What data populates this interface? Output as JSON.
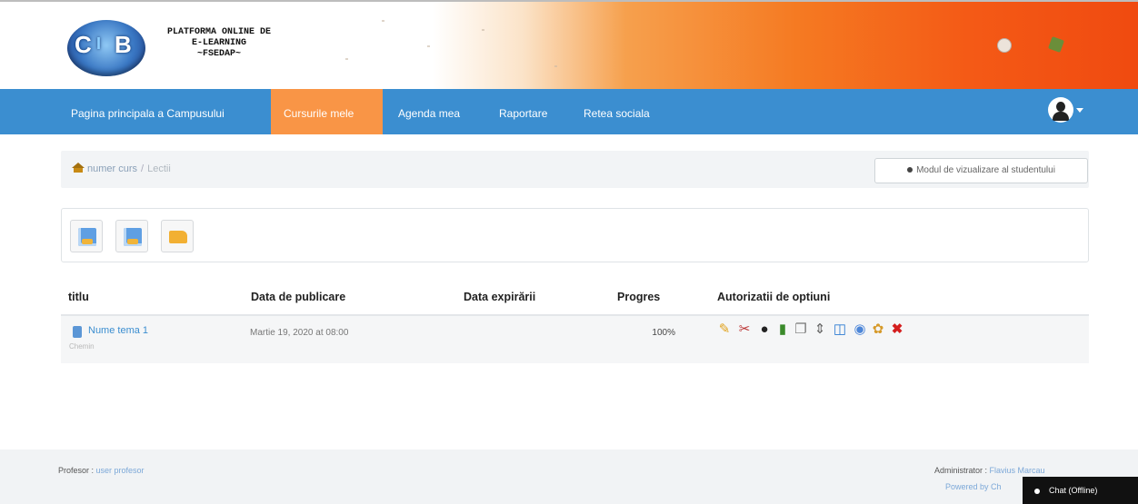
{
  "header": {
    "logo_letters": [
      "C",
      "I",
      "B"
    ],
    "site_title_lines": [
      "PLATFORMA ONLINE DE",
      "E-LEARNING",
      "~FSEDAP~"
    ]
  },
  "nav": {
    "items": [
      {
        "label": "Pagina principala a Campusului",
        "active": false
      },
      {
        "label": "Cursurile mele",
        "active": true
      },
      {
        "label": "Agenda mea",
        "active": false
      },
      {
        "label": "Raportare",
        "active": false
      },
      {
        "label": "Retea sociala",
        "active": false
      }
    ],
    "active_color": "#f99546",
    "bar_color": "#3b8ed0"
  },
  "breadcrumb": {
    "items": [
      "numer curs",
      "Lectii"
    ],
    "separator": "/"
  },
  "student_view_button": "Modul de vizualizare al studentului",
  "toolbar": {
    "icons": [
      "new-lesson-icon",
      "lesson-icon",
      "folder-icon"
    ]
  },
  "table": {
    "headers": [
      "titlu",
      "Data de publicare",
      "Data expirării",
      "Progres",
      "Autorizatii de optiuni"
    ],
    "rows": [
      {
        "title": "Nume tema 1",
        "subtitle": "Chemin",
        "published": "Martie 19, 2020 at 08:00",
        "expires": "",
        "progress": "100%"
      }
    ],
    "action_icons": [
      "edit-icon",
      "settings-icon",
      "visibility-icon",
      "stats-icon",
      "copy-icon",
      "move-icon",
      "layout-icon",
      "target-icon",
      "share-icon",
      "delete-icon"
    ]
  },
  "footer": {
    "professor_label": "Profesor :",
    "professor_name": "user profesor",
    "admin_label": "Administrator :",
    "admin_name": "Flavius Marcau",
    "powered_by": "Powered by Ch"
  },
  "chat": {
    "label": "Chat (Offline)"
  }
}
